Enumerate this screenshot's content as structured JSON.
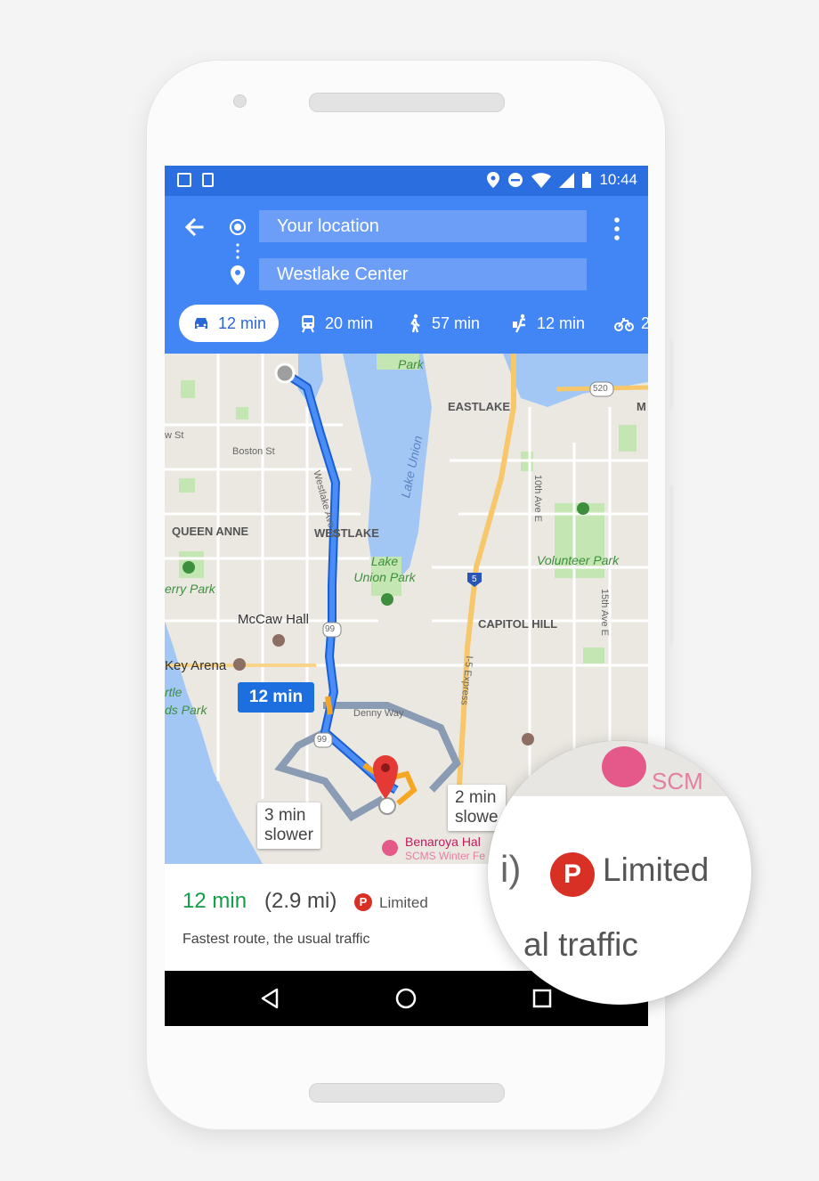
{
  "statusbar": {
    "time": "10:44"
  },
  "search": {
    "origin": "Your location",
    "destination": "Westlake Center"
  },
  "modes": [
    {
      "icon": "car-icon",
      "label": "12 min",
      "active": true
    },
    {
      "icon": "transit-icon",
      "label": "20 min",
      "active": false
    },
    {
      "icon": "walk-icon",
      "label": "57 min",
      "active": false
    },
    {
      "icon": "rideshare-icon",
      "label": "12 min",
      "active": false
    },
    {
      "icon": "bike-icon",
      "label": "2",
      "active": false
    }
  ],
  "map": {
    "labels": {
      "park_top": "Park",
      "eastlake": "EASTLAKE",
      "m": "M",
      "w_st": "w St",
      "boston_st": "Boston St",
      "westlake_ave": "Westlake Ave N",
      "lake_union": "Lake Union",
      "tenth_ave": "10th Ave E",
      "queen_anne": "QUEEN ANNE",
      "westlake": "WESTLAKE",
      "volunteer_park": "Volunteer Park",
      "lake_union_park": "Lake Union Park",
      "kerry_park": "erry Park",
      "mccaw_hall": "McCaw Hall",
      "capitol_hill": "CAPITOL HILL",
      "fifteenth_ave": "15th Ave E",
      "key_arena": "Key Arena",
      "myrtle": "rtle",
      "edwards_park": "ds Park",
      "i5_express": "I-5 Express",
      "denny_way": "Denny Way",
      "benaroya": "Benaroya Hal",
      "scms": "SCMS Winter Fe",
      "shield_99a": "99",
      "shield_99b": "99",
      "shield_520": "520",
      "shield_5": "5"
    },
    "route_badge": "12 min",
    "alt_badges": [
      {
        "line1": "3 min",
        "line2": "slower"
      },
      {
        "line1": "2 min",
        "line2": "slowe"
      }
    ]
  },
  "summary": {
    "eta": "12 min",
    "distance": "(2.9 mi)",
    "parking_icon": "P",
    "parking": "Limited",
    "description": "Fastest route, the usual traffic"
  },
  "magnifier": {
    "paren": "i)",
    "parking_icon": "P",
    "parking": "Limited",
    "traffic": "al traffic",
    "scm": "SCM"
  },
  "colors": {
    "header": "#4285f4",
    "statusbar": "#2b6ee0",
    "route": "#4a8df8",
    "eta_green": "#129e48",
    "parking_red": "#d93025"
  }
}
